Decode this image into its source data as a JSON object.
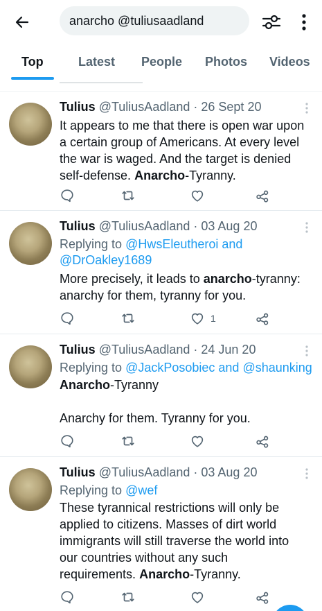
{
  "search": {
    "query": "anarcho @tuliusaadland"
  },
  "tabs": [
    {
      "label": "Top",
      "active": true
    },
    {
      "label": "Latest",
      "active": false
    },
    {
      "label": "People",
      "active": false
    },
    {
      "label": "Photos",
      "active": false
    },
    {
      "label": "Videos",
      "active": false
    }
  ],
  "icons": {
    "back": "arrow-left-icon",
    "filter": "sliders-icon",
    "more": "vertical-ellipsis-icon",
    "reply": "comment-icon",
    "retweet": "retweet-icon",
    "like": "heart-icon",
    "share": "share-icon"
  },
  "colors": {
    "accent": "#1d9bf0",
    "text": "#0f1419",
    "muted": "#536471"
  },
  "tweets": [
    {
      "name": "Tulius",
      "handle": "@TuliusAadland",
      "date": "· 26 Sept 20",
      "lines": [
        "It appears to me that there is open war upon",
        "a certain group of Americans. At every level",
        "the war is waged. And the target is denied",
        "self-defense."
      ],
      "bold": "Anarcho",
      "tail": "-Tyranny.",
      "likes": ""
    },
    {
      "name": "Tulius",
      "handle": "@TuliusAadland",
      "date": "· 03 Aug 20",
      "reply_prefix": "Replying to",
      "reply_link_1": "@HwsEleutheroi and",
      "reply_link_2": "@DrOakley1689",
      "text_before": "More precisely, it leads to",
      "bold": "anarcho",
      "text_after": "-tyranny:",
      "line2": "anarchy for them, tyranny for you.",
      "likes": "1"
    },
    {
      "name": "Tulius",
      "handle": "@TuliusAadland",
      "date": "· 24 Jun 20",
      "reply_prefix": "Replying to",
      "reply_link": "@JackPosobiec and @shaunking",
      "bold": "Anarcho",
      "tail": "-Tyranny",
      "line3": "Anarchy for them. Tyranny for you.",
      "likes": ""
    },
    {
      "name": "Tulius",
      "handle": "@TuliusAadland",
      "date": "· 03 Aug 20",
      "reply_prefix": "Replying to",
      "reply_link": "@wef",
      "lines": [
        "These tyrannical restrictions will only be",
        "applied to citizens. Masses of dirt world",
        "immigrants will still traverse the world into",
        "our countries without any such"
      ],
      "last_before": "requirements.",
      "bold": "Anarcho",
      "tail": "-Tyranny.",
      "likes": ""
    }
  ]
}
